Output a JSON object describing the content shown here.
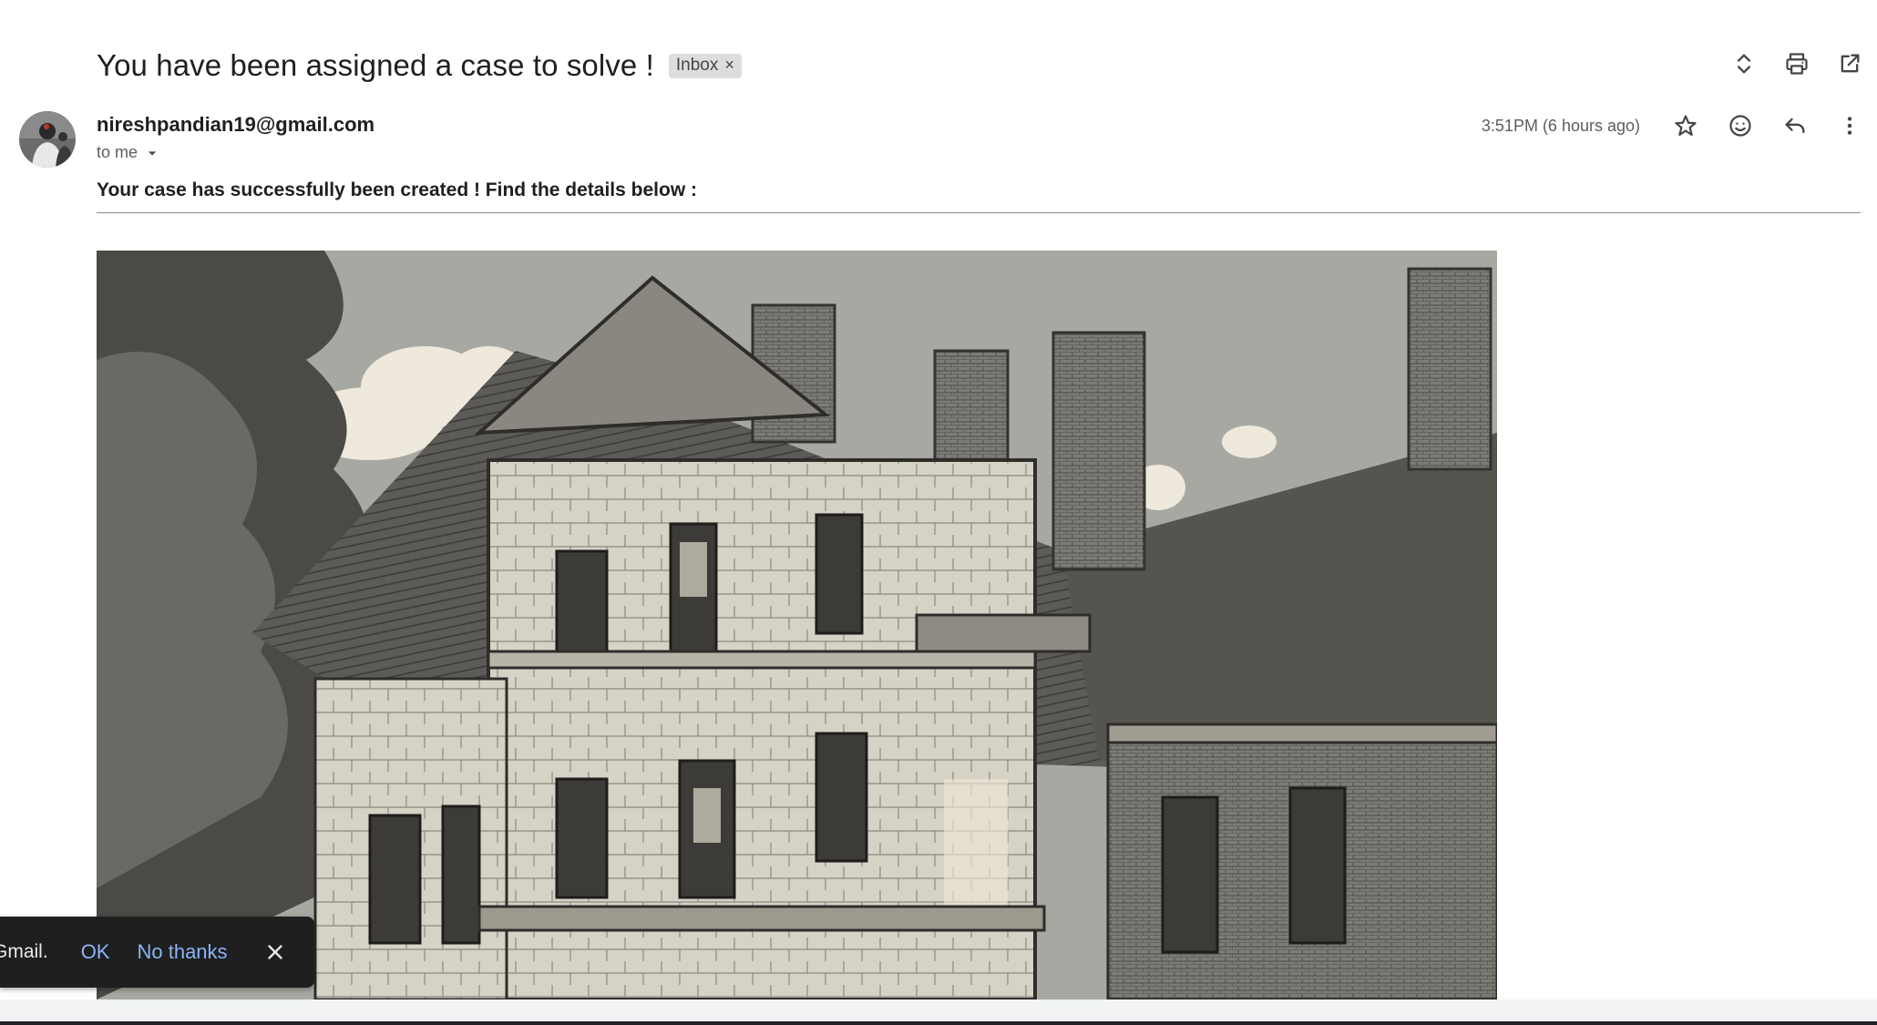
{
  "email": {
    "subject": "You have been assigned a case to solve !",
    "label": "Inbox",
    "label_remove": "×",
    "sender": "nireshpandian19@gmail.com",
    "recipient": "to me",
    "timestamp": "3:51PM (6 hours ago)",
    "body": "Your case has successfully been created ! Find the details below :"
  },
  "icons": {
    "top_actions": [
      "expand-collapse-icon",
      "print-icon",
      "open-in-new-window-icon"
    ],
    "message_actions": [
      "star-icon",
      "emoji-reaction-icon",
      "reply-icon",
      "more-vert-icon"
    ],
    "recipient_toggle": "chevron-down-icon",
    "snackbar_close": "close-icon"
  },
  "snackbar": {
    "message": "Gmail.",
    "ok": "OK",
    "dismiss": "No thanks"
  },
  "colors": {
    "snackbar_bg": "#1f1f1f",
    "snackbar_action": "#8ab4f8",
    "label_chip_bg": "#dddddd"
  }
}
